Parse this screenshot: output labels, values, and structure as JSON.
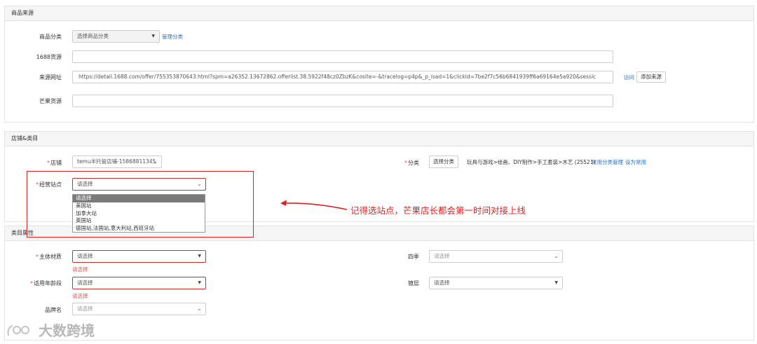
{
  "source_section": {
    "title": "商品来源",
    "category_label": "商品分类",
    "category_select": "选择商品分类",
    "manage_category": "管理分类",
    "source_1688_label": "1688货源",
    "source_url_label": "来源网址",
    "source_url_value": "https://detail.1688.com/offer/755353870643.html?spm=a26352.13672862.offerlist.38.5922f48cz0ZbzK&cosite=-&tracelog=p4p&_p_isad=1&clickid=7be2f7c56b6841939ff6a69164e5a920&sessic",
    "visit_link": "访问",
    "add_source_button": "添加来源",
    "mango_source_label": "芒果货源"
  },
  "store_section": {
    "title": "店铺&类目",
    "store_label": "店铺",
    "store_value": "temu半托管店铺-15868811345",
    "category_label": "分类",
    "choose_category_button": "选择分类",
    "category_path": "玩具与游戏>绘画、DIY制作>手工套装>木艺 (25521)",
    "common_category_manage": "常用分类管理",
    "set_common": "设为常用",
    "site_label": "经营站点",
    "site_placeholder": "请选择",
    "site_options": [
      "请选择",
      "美国站",
      "加拿大站",
      "英国站",
      "德国站,法国站,意大利站,西班牙站"
    ]
  },
  "attr_section": {
    "title": "类目属性",
    "material_label": "主体材质",
    "material_value": "请选择",
    "material_error": "请选择",
    "season_label": "四季",
    "season_value": "请选择",
    "age_label": "适用年龄段",
    "age_value": "请选择",
    "age_error": "请选择",
    "plating_label": "镀层",
    "plating_value": "请选择",
    "brand_label": "品牌名",
    "brand_value": "请选择"
  },
  "annotation": {
    "text": "记得选站点，芒果店长都会第一时间对接上线"
  },
  "watermark": {
    "text": "大数跨境"
  },
  "colors": {
    "accent_red": "#e02020",
    "error_red": "#d9534f",
    "link_blue": "#2a6ebb"
  }
}
